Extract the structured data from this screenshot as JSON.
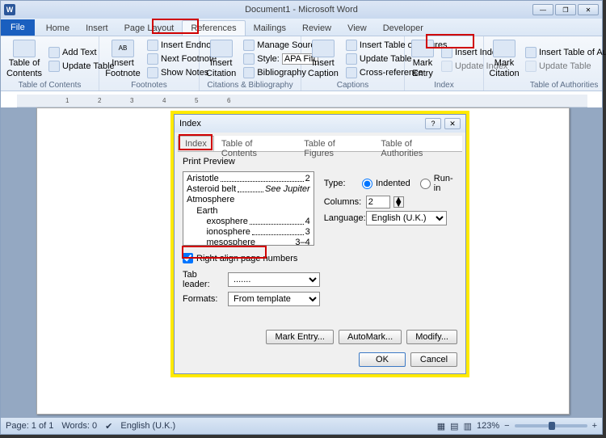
{
  "titlebar": {
    "title": "Document1 - Microsoft Word"
  },
  "tabs": {
    "file": "File",
    "home": "Home",
    "insert": "Insert",
    "page_layout": "Page Layout",
    "references": "References",
    "mailings": "Mailings",
    "review": "Review",
    "view": "View",
    "developer": "Developer"
  },
  "ribbon": {
    "toc": {
      "big": "Table of Contents",
      "add_text": "Add Text",
      "update": "Update Table",
      "group": "Table of Contents"
    },
    "footnotes": {
      "big": "Insert Footnote",
      "endnote": "Insert Endnote",
      "next": "Next Footnote",
      "show": "Show Notes",
      "group": "Footnotes",
      "ab": "AB"
    },
    "citations": {
      "big": "Insert Citation",
      "manage": "Manage Sources",
      "style_label": "Style:",
      "style_value": "APA Fift",
      "biblio": "Bibliography",
      "group": "Citations & Bibliography"
    },
    "captions": {
      "big": "Insert Caption",
      "tof": "Insert Table of Figures",
      "update": "Update Table",
      "cross": "Cross-reference",
      "group": "Captions"
    },
    "index": {
      "big": "Mark Entry",
      "insert": "Insert Index",
      "update": "Update Index",
      "group": "Index"
    },
    "toa": {
      "big": "Mark Citation",
      "insert": "Insert Table of Authorities",
      "update": "Update Table",
      "group": "Table of Authorities"
    }
  },
  "dialog": {
    "title": "Index",
    "tabs": {
      "index": "Index",
      "toc": "Table of Contents",
      "tof": "Table of Figures",
      "toa": "Table of Authorities"
    },
    "preview_label": "Print Preview",
    "preview": [
      {
        "text": "Aristotle",
        "page": "2"
      },
      {
        "text": "Asteroid belt",
        "see": "See Jupiter"
      },
      {
        "text": "Atmosphere",
        "page": ""
      },
      {
        "text": "    Earth",
        "page": ""
      },
      {
        "text": "        exosphere",
        "page": "4"
      },
      {
        "text": "        ionosphere",
        "page": "3"
      },
      {
        "text": "        mesosphere",
        "page": "3–4"
      }
    ],
    "type_label": "Type:",
    "type_indented": "Indented",
    "type_runin": "Run-in",
    "columns_label": "Columns:",
    "columns_value": "2",
    "language_label": "Language:",
    "language_value": "English (U.K.)",
    "right_align": "Right align page numbers",
    "tab_leader": "Tab leader:",
    "tab_leader_value": ".......",
    "formats_label": "Formats:",
    "formats_value": "From template",
    "mark_entry": "Mark Entry...",
    "automark": "AutoMark...",
    "modify": "Modify...",
    "ok": "OK",
    "cancel": "Cancel"
  },
  "status": {
    "page": "Page: 1 of 1",
    "words": "Words: 0",
    "lang": "English (U.K.)",
    "zoom": "123%"
  }
}
